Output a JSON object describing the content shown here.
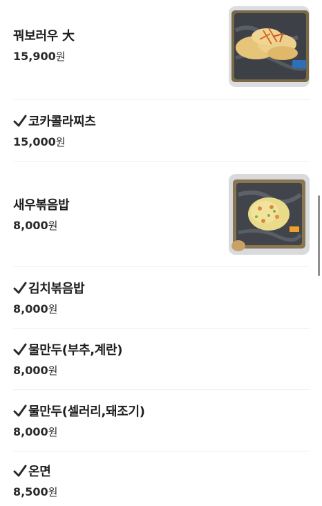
{
  "menu": {
    "items": [
      {
        "name": "꿔보러우 大",
        "price": "15,900",
        "currency": "원",
        "checked": false,
        "has_image": true,
        "image_icon": "fried-pork-photo"
      },
      {
        "name": "코카콜라찌츠",
        "price": "15,000",
        "currency": "원",
        "checked": true,
        "has_image": false
      },
      {
        "name": "새우볶음밥",
        "price": "8,000",
        "currency": "원",
        "checked": false,
        "has_image": true,
        "image_icon": "shrimp-fried-rice-photo"
      },
      {
        "name": "김치볶음밥",
        "price": "8,000",
        "currency": "원",
        "checked": true,
        "has_image": false
      },
      {
        "name": "물만두(부추,계란)",
        "price": "8,000",
        "currency": "원",
        "checked": true,
        "has_image": false
      },
      {
        "name": "물만두(셀러리,돼조기)",
        "price": "8,000",
        "currency": "원",
        "checked": true,
        "has_image": false
      },
      {
        "name": "온면",
        "price": "8,500",
        "currency": "원",
        "checked": true,
        "has_image": false
      }
    ]
  },
  "icons": {
    "check": "check-icon"
  },
  "colors": {
    "text": "#1e1e1e",
    "divider": "#efefef",
    "scrollbar": "#8f8f8f"
  }
}
